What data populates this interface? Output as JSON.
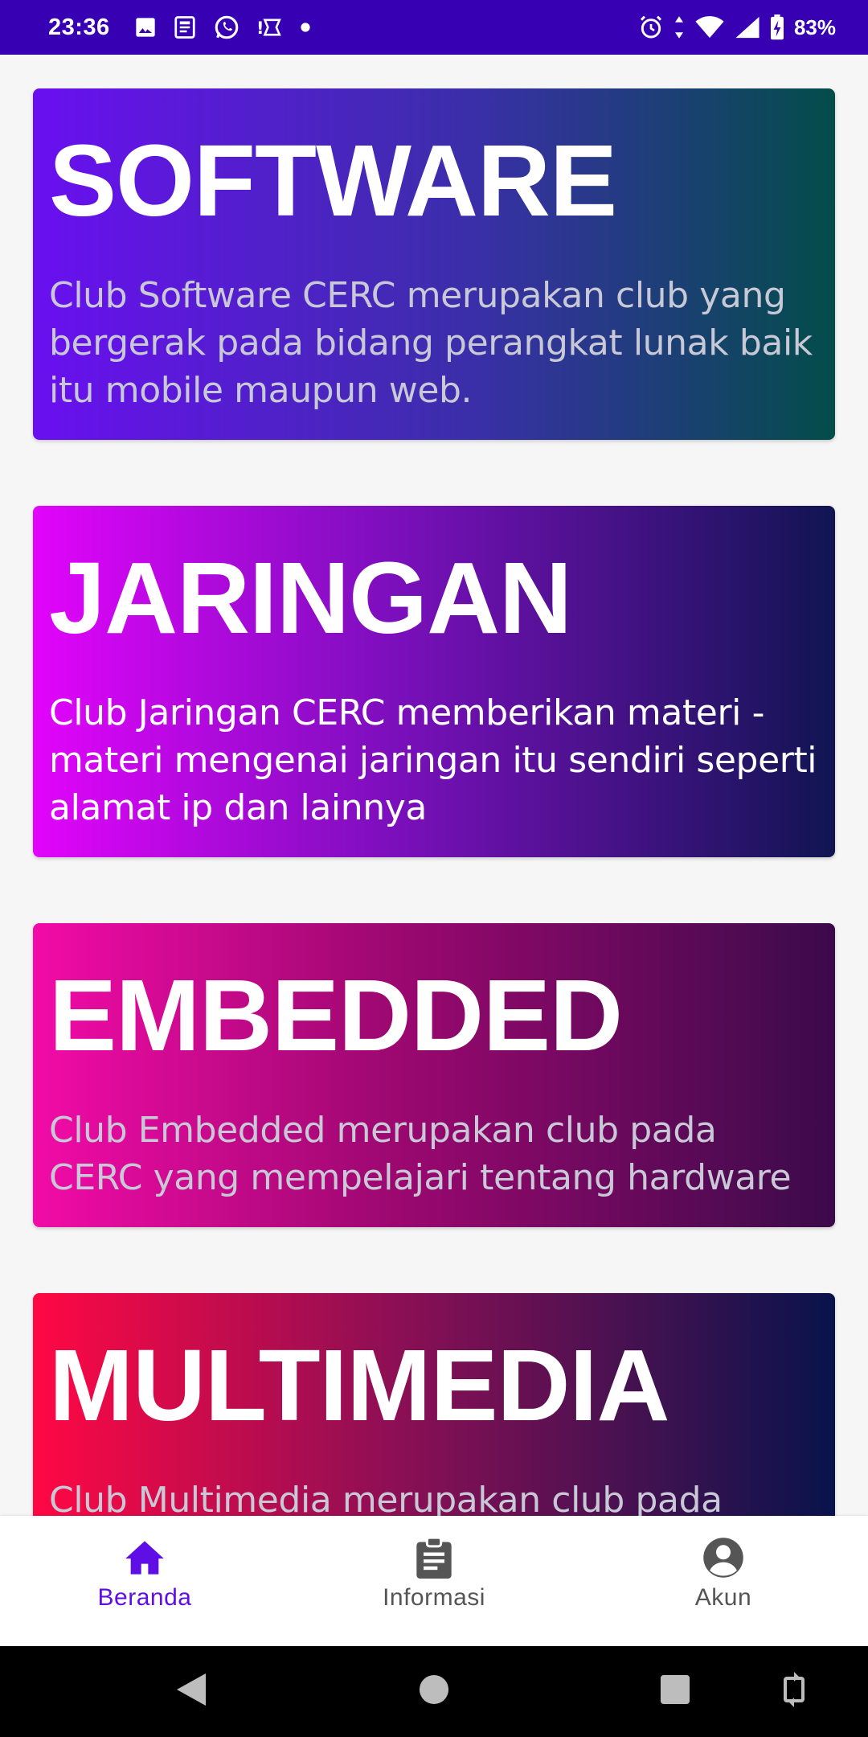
{
  "status_bar": {
    "time": "23:36",
    "battery_percent": "83%",
    "left_icons": [
      "image-icon",
      "news-icon",
      "whatsapp-icon",
      "app-icon",
      "dot-icon"
    ],
    "right_icons": [
      "alarm-icon",
      "data-arrows-icon",
      "wifi-icon",
      "signal-icon",
      "battery-charging-icon"
    ]
  },
  "cards": [
    {
      "title": "SOFTWARE",
      "description": "Club Software CERC merupakan club yang bergerak pada bidang perangkat lunak baik itu mobile maupun web.",
      "gradient": [
        "#6a0ff0",
        "#034d4a"
      ]
    },
    {
      "title": "JARINGAN",
      "description": "Club Jaringan CERC memberikan materi - materi mengenai jaringan itu sendiri seperti alamat ip dan lainnya",
      "gradient": [
        "#e204fb",
        "#101552"
      ]
    },
    {
      "title": "EMBEDDED",
      "description": "Club Embedded merupakan club pada CERC yang mempelajari tentang hardware",
      "gradient": [
        "#f20ba7",
        "#3b0a4a"
      ]
    },
    {
      "title": "MULTIMEDIA",
      "description": "Club Multimedia merupakan club pada",
      "gradient": [
        "#ff0844",
        "#08134c"
      ]
    }
  ],
  "bottom_nav": {
    "items": [
      {
        "label": "Beranda",
        "icon": "home-icon",
        "active": true
      },
      {
        "label": "Informasi",
        "icon": "clipboard-icon",
        "active": false
      },
      {
        "label": "Akun",
        "icon": "account-icon",
        "active": false
      }
    ],
    "active_color": "#5f0fe5",
    "inactive_color": "#555555"
  },
  "theme": {
    "status_bar_color": "#3700b3",
    "background": "#f6f6f6"
  }
}
